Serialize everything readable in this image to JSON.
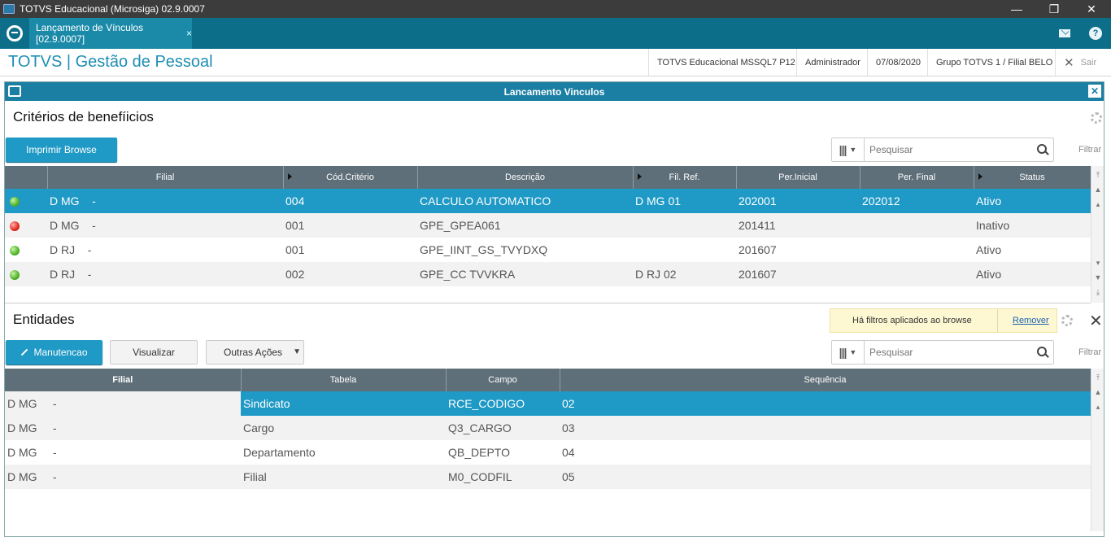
{
  "window": {
    "title": "TOTVS Educacional (Microsiga) 02.9.0007",
    "minimize": "—",
    "restore": "❐",
    "close": "✕"
  },
  "tabbar": {
    "tab_label": "Lançamento de Vínculos [02.9.0007]",
    "tab_close": "×",
    "help": "?"
  },
  "header": {
    "brand": "TOTVS | Gestão de Pessoal",
    "environment": "TOTVS Educacional MSSQL7 P12",
    "user": "Administrador",
    "date": "07/08/2020",
    "branch": "Grupo TOTVS 1 / Filial BELO",
    "logout_icon": "✕",
    "logout": "Sair"
  },
  "dialog": {
    "title": "Lancamento Vinculos",
    "close": "✕"
  },
  "criterios": {
    "title": "Critérios de benefíicios",
    "print_button": "Imprimir Browse",
    "search_placeholder": "Pesquisar",
    "filter_label": "Filtrar",
    "columns": [
      "",
      "Filial",
      "Cód.Critério",
      "Descrição",
      "Fil. Ref.",
      "Per.Inicial",
      "Per. Final",
      "Status"
    ],
    "rows": [
      {
        "status_color": "green",
        "filial": "D MG",
        "filial_sep": "-",
        "codigo": "004",
        "descricao": "CALCULO AUTOMATICO",
        "fil_ref": "D MG 01",
        "per_inicial": "202001",
        "per_final": "202012",
        "status": "Ativo"
      },
      {
        "status_color": "red",
        "filial": "D MG",
        "filial_sep": "-",
        "codigo": "001",
        "descricao": "GPE_GPEA061",
        "fil_ref": "",
        "per_inicial": "201411",
        "per_final": "",
        "status": "Inativo"
      },
      {
        "status_color": "green",
        "filial": "D RJ",
        "filial_sep": "-",
        "codigo": "001",
        "descricao": "GPE_IINT_GS_TVYDXQ",
        "fil_ref": "",
        "per_inicial": "201607",
        "per_final": "",
        "status": "Ativo"
      },
      {
        "status_color": "green",
        "filial": "D RJ",
        "filial_sep": "-",
        "codigo": "002",
        "descricao": "GPE_CC TVVKRA",
        "fil_ref": "D RJ 02",
        "per_inicial": "201607",
        "per_final": "",
        "status": "Ativo"
      }
    ]
  },
  "entidades": {
    "title": "Entidades",
    "filter_notice": "Há filtros aplicados ao browse",
    "remove_filter": "Remover",
    "close": "✕",
    "buttons": {
      "manutencao": "Manutencao",
      "visualizar": "Visualizar",
      "outras_acoes": "Outras Ações"
    },
    "search_placeholder": "Pesquisar",
    "filter_label": "Filtrar",
    "columns": [
      "Filial",
      "Tabela",
      "Campo",
      "Sequência"
    ],
    "rows": [
      {
        "filial": "D MG",
        "filial_sep": "-",
        "tabela": "Sindicato",
        "campo": "RCE_CODIGO",
        "sequencia": "02"
      },
      {
        "filial": "D MG",
        "filial_sep": "-",
        "tabela": "Cargo",
        "campo": "Q3_CARGO",
        "sequencia": "03"
      },
      {
        "filial": "D MG",
        "filial_sep": "-",
        "tabela": "Departamento",
        "campo": "QB_DEPTO",
        "sequencia": "04"
      },
      {
        "filial": "D MG",
        "filial_sep": "-",
        "tabela": "Filial",
        "campo": "M0_CODFIL",
        "sequencia": "05"
      }
    ]
  },
  "colors": {
    "accent": "#1f99c5",
    "tabbar": "#0d6e8a",
    "grid_header": "#5f6f79",
    "status_active": "#4fb428",
    "status_inactive": "#e12a1d"
  }
}
